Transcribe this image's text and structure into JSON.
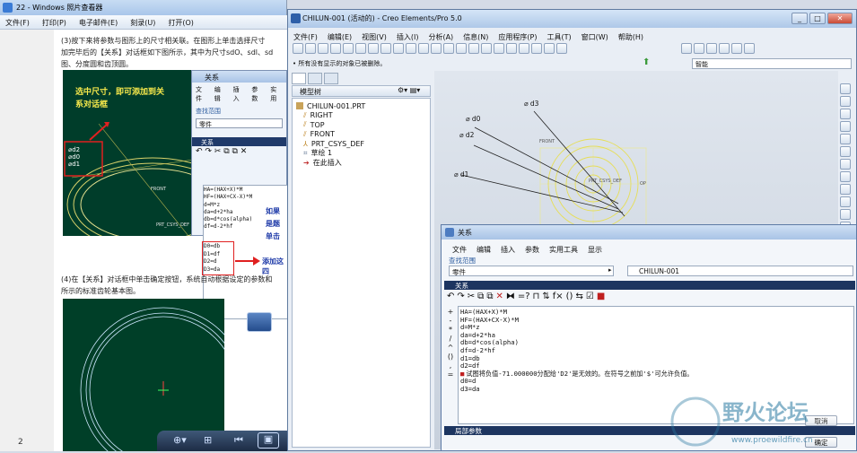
{
  "photo_viewer": {
    "title": "22 - Windows 照片查看器",
    "menu": [
      "文件(F)",
      "打印(P)",
      "电子邮件(E)",
      "刻录(U)",
      "打开(O)"
    ],
    "para1_lines": [
      "(3)按下来将参数与图形上的尺寸相关联。在图形上单击选择尺寸",
      "加完毕后的【关系】对话框如下图所示，其中为尺寸sdO、sdl、sd",
      "图、分度圆和齿顶圆。"
    ],
    "callout1": "选中尺寸，即可添加到关系对话框",
    "callout2_lines": [
      "如果",
      "是题",
      "单击"
    ],
    "callout3": "添加这四",
    "img_dims": [
      "⌀d2",
      "⌀d0",
      "⌀d1"
    ],
    "img_front": "FRONT",
    "img_csys": "PRT_CSYS_DEF",
    "mini_rel": {
      "title": "关系",
      "menu": [
        "文件",
        "编辑",
        "插入",
        "参数",
        "实用"
      ],
      "lookup": "查找范围",
      "part": "零件",
      "sub": "关系",
      "code": [
        "HA=(HAX+X)*M",
        "HF=(HAX+CX-X)*M",
        "d=M*z",
        "da=d+2*ha",
        "db=d*cos(alpha)",
        "df=d-2*hf"
      ],
      "highlight": [
        "D0=db",
        "D1=df",
        "D2=d",
        "D3=da"
      ]
    },
    "para2_lines": [
      "(4)在【关系】对话框中单击确定按钮，系统自动根据设定的参数和",
      "所示的标准齿轮基本图。"
    ]
  },
  "creo": {
    "title": "CHILUN-001 (活动的) - Creo Elements/Pro 5.0",
    "menu": [
      "文件(F)",
      "编辑(E)",
      "视图(V)",
      "插入(I)",
      "分析(A)",
      "信息(N)",
      "应用程序(P)",
      "工具(T)",
      "窗口(W)",
      "帮助(H)"
    ],
    "status_msg": "• 所有没有显示的对象已被删除。",
    "filter": "智能",
    "tree_tab": "模型树",
    "tree": [
      {
        "label": "CHILUN-001.PRT",
        "icon": "part-icon"
      },
      {
        "label": "RIGHT",
        "icon": "plane-icon"
      },
      {
        "label": "TOP",
        "icon": "plane-icon"
      },
      {
        "label": "FRONT",
        "icon": "plane-icon"
      },
      {
        "label": "PRT_CSYS_DEF",
        "icon": "csys-icon"
      },
      {
        "label": "草绘 1",
        "icon": "sketch-icon"
      },
      {
        "label": "在此插入",
        "icon": "insert-arrow-icon"
      }
    ],
    "dims": [
      "⌀ d3",
      "⌀ d0",
      "⌀ d2",
      "⌀ d1"
    ],
    "view_front": "FRONT",
    "view_csys": "PRT_CSYS_DEF",
    "view_top": "OP",
    "relations": {
      "title": "关系",
      "menu": [
        "文件",
        "编辑",
        "插入",
        "参数",
        "实用工具",
        "显示"
      ],
      "lookup": "查找范围",
      "part_select": "零件",
      "part_name": "CHILUN-001",
      "sub": "关系",
      "code": [
        "HA=(HAX+X)*M",
        "HF=(HAX+CX-X)*M",
        "d=M*z",
        "da=d+2*ha",
        "db=d*cos(alpha)",
        "df=d-2*hf",
        "d1=db",
        "d2=df"
      ],
      "error": "试图将负值-71.000000分配给'D2'是无效的。在符号之前加'$'可允许负值。",
      "code_after": [
        "d0=d",
        "d3=da"
      ],
      "local_params": "局部参数",
      "ok": "确定",
      "cancel": "取消"
    }
  },
  "watermark": {
    "big": "野火论坛",
    "url": "www.proewildfire.cn"
  },
  "taskbar_ts": "2"
}
